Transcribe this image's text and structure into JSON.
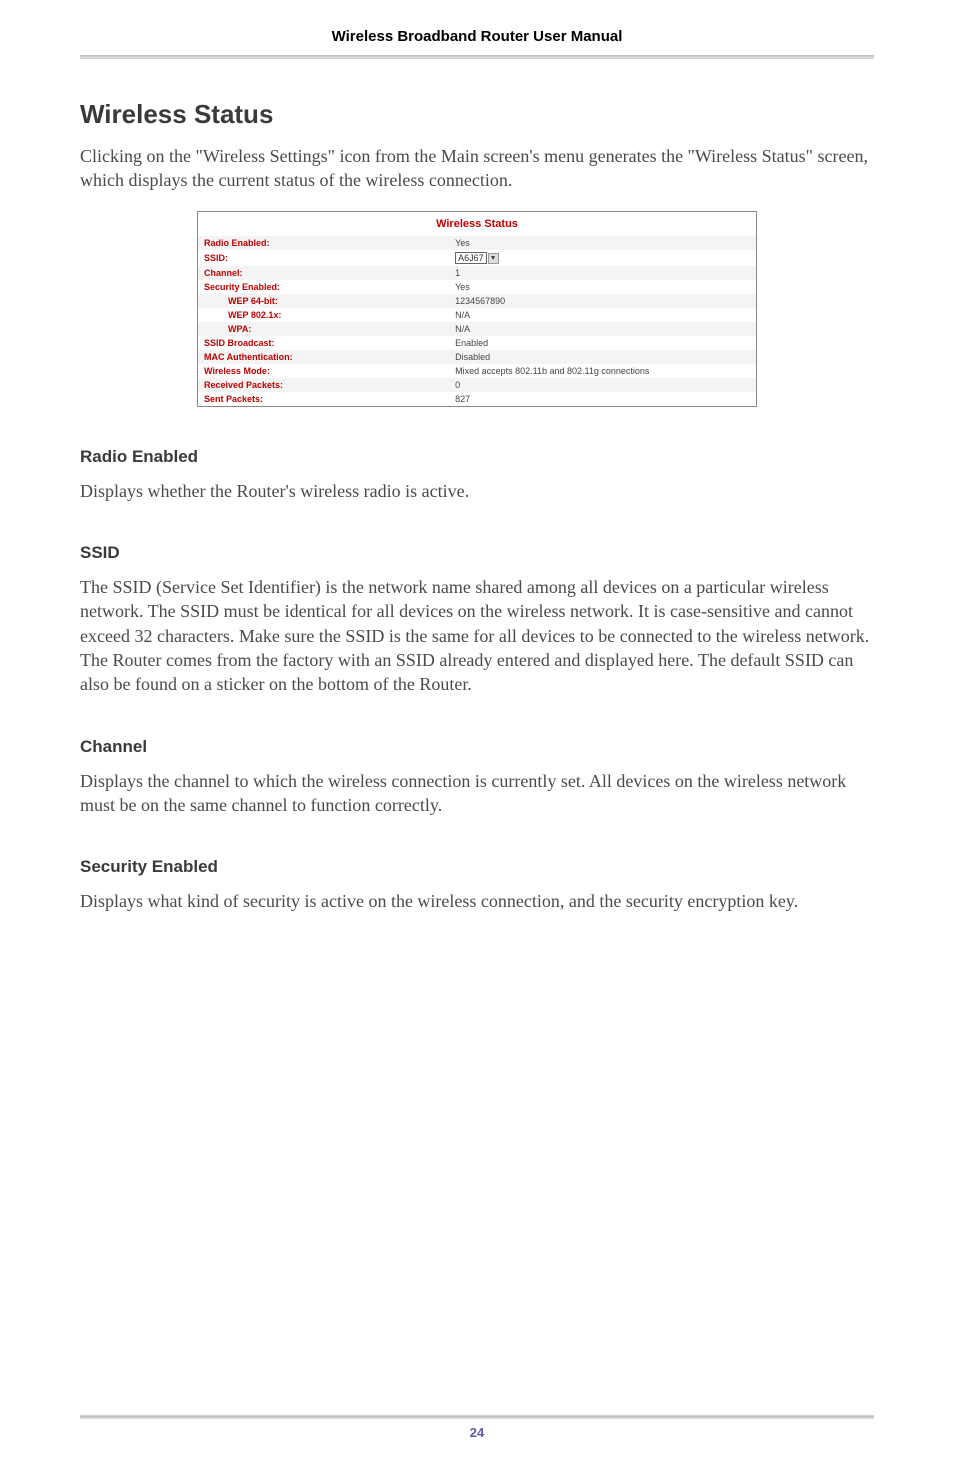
{
  "header": {
    "title": "Wireless Broadband Router User Manual"
  },
  "section": {
    "title": "Wireless Status"
  },
  "intro": "Clicking on the \"Wireless Settings\" icon from the Main screen's menu generates the \"Wireless Status\"  screen, which displays the current status of the wireless connection.",
  "status_panel": {
    "caption": "Wireless Status",
    "rows": [
      {
        "label": "Radio Enabled:",
        "value": "Yes",
        "indent": false,
        "is_select": false
      },
      {
        "label": "SSID:",
        "value": "A6J67",
        "indent": false,
        "is_select": true
      },
      {
        "label": "Channel:",
        "value": "1",
        "indent": false,
        "is_select": false
      },
      {
        "label": "Security Enabled:",
        "value": "Yes",
        "indent": false,
        "is_select": false
      },
      {
        "label": "WEP 64-bit:",
        "value": "1234567890",
        "indent": true,
        "is_select": false
      },
      {
        "label": "WEP 802.1x:",
        "value": "N/A",
        "indent": true,
        "is_select": false
      },
      {
        "label": "WPA:",
        "value": "N/A",
        "indent": true,
        "is_select": false
      },
      {
        "label": "SSID Broadcast:",
        "value": "Enabled",
        "indent": false,
        "is_select": false
      },
      {
        "label": "MAC Authentication:",
        "value": "Disabled",
        "indent": false,
        "is_select": false
      },
      {
        "label": "Wireless Mode:",
        "value": "Mixed accepts 802.11b and 802.11g connections",
        "indent": false,
        "is_select": false
      },
      {
        "label": "Received Packets:",
        "value": "0",
        "indent": false,
        "is_select": false
      },
      {
        "label": "Sent Packets:",
        "value": "827",
        "indent": false,
        "is_select": false
      }
    ]
  },
  "subsections": [
    {
      "heading": "Radio Enabled",
      "body": "Displays whether the Router's wireless radio is active."
    },
    {
      "heading": "SSID",
      "body": "The SSID (Service Set Identifier) is the network name shared among all devices on a particular wireless network. The SSID must be identical for all devices on the wireless network. It is case-sensitive and cannot exceed 32 characters. Make sure the SSID is the same for all devices to be connected to the wireless network. The Router comes from the factory with an SSID already entered and displayed here. The default SSID can also be found on a sticker on the bottom of the Router."
    },
    {
      "heading": "Channel",
      "body": "Displays the channel to which the wireless connection is currently set. All devices on the wireless network must be on the same channel to function correctly."
    },
    {
      "heading": "Security Enabled",
      "body": "Displays what kind of security is active on the wireless connection, and the security encryption key."
    }
  ],
  "page_number": "24"
}
